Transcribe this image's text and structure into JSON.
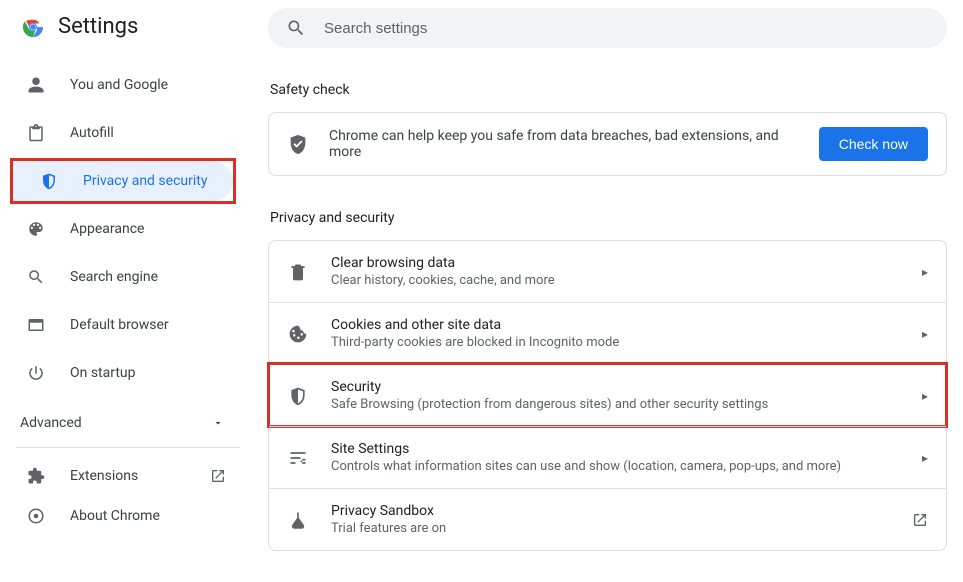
{
  "header": {
    "title": "Settings"
  },
  "search": {
    "placeholder": "Search settings"
  },
  "sidebar": {
    "items": [
      {
        "label": "You and Google"
      },
      {
        "label": "Autofill"
      },
      {
        "label": "Privacy and security"
      },
      {
        "label": "Appearance"
      },
      {
        "label": "Search engine"
      },
      {
        "label": "Default browser"
      },
      {
        "label": "On startup"
      }
    ],
    "advanced_label": "Advanced",
    "footer": {
      "extensions": "Extensions",
      "about": "About Chrome"
    }
  },
  "safety": {
    "section_title": "Safety check",
    "message": "Chrome can help keep you safe from data breaches, bad extensions, and more",
    "button": "Check now"
  },
  "privacy": {
    "section_title": "Privacy and security",
    "rows": [
      {
        "title": "Clear browsing data",
        "sub": "Clear history, cookies, cache, and more"
      },
      {
        "title": "Cookies and other site data",
        "sub": "Third-party cookies are blocked in Incognito mode"
      },
      {
        "title": "Security",
        "sub": "Safe Browsing (protection from dangerous sites) and other security settings"
      },
      {
        "title": "Site Settings",
        "sub": "Controls what information sites can use and show (location, camera, pop-ups, and more)"
      },
      {
        "title": "Privacy Sandbox",
        "sub": "Trial features are on"
      }
    ]
  }
}
